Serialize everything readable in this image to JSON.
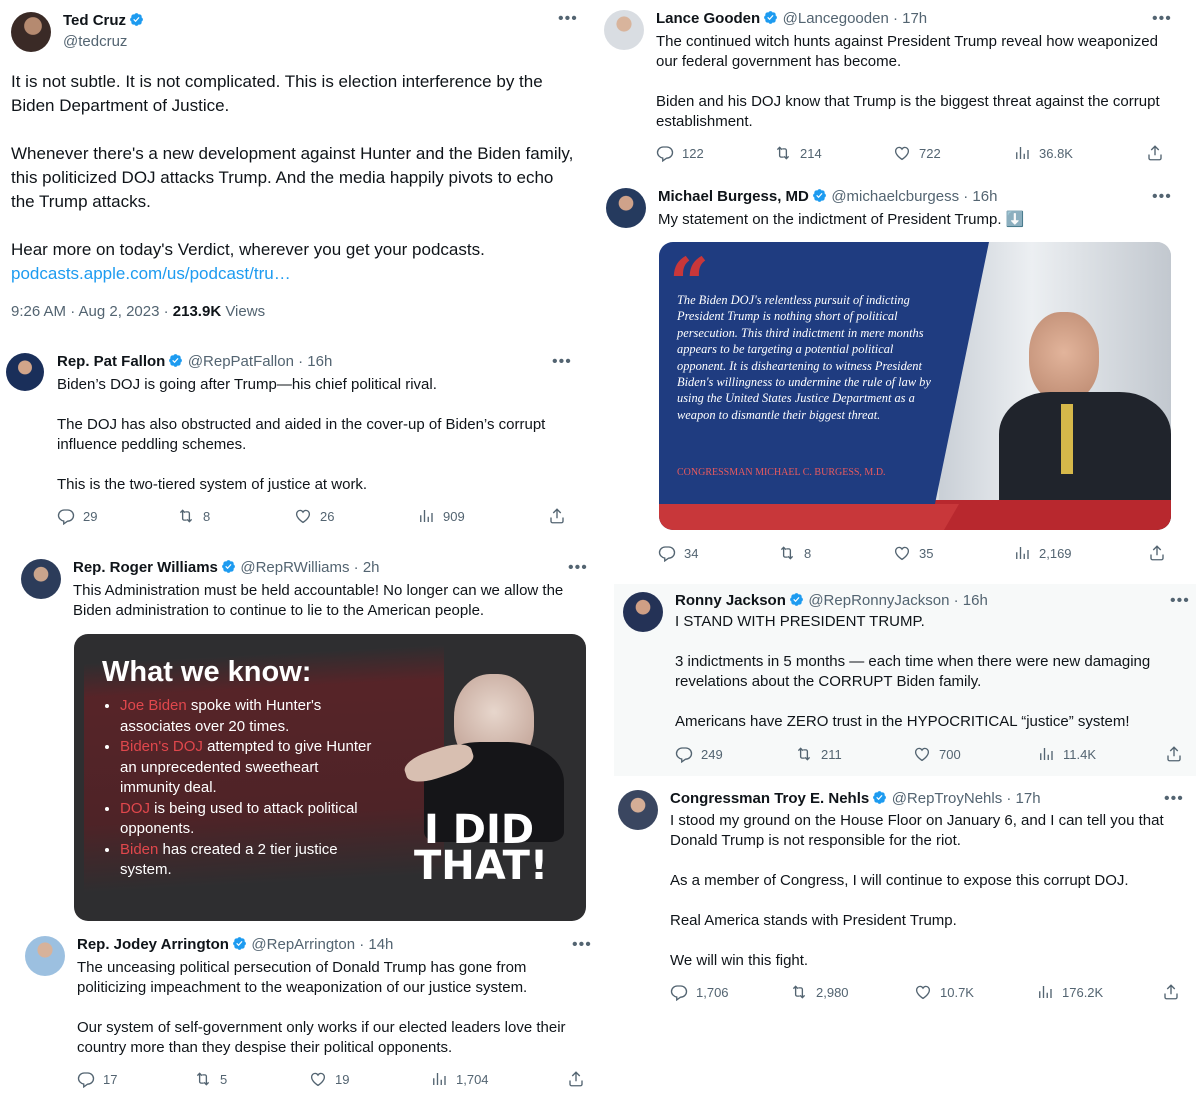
{
  "colors": {
    "accent": "#1d9bf0",
    "text": "#0f1419",
    "muted": "#536471",
    "verified": "#1d9bf0",
    "gray_bg": "#f7f9f9",
    "doj_blue": "#1e3a78",
    "doj_red": "#c8373a"
  },
  "icons": {
    "reply": "reply-icon",
    "repost": "repost-icon",
    "like": "like-icon",
    "views": "views-icon",
    "share": "share-icon",
    "verified": "verified-badge-icon",
    "more": "more-icon"
  },
  "cruz": {
    "name": "Ted Cruz",
    "handle": "@tedcruz",
    "p1": "It is not subtle. It is not complicated. This is election interference by the Biden Department of Justice.",
    "p2": "Whenever there's a new development against Hunter and the Biden family, this politicized DOJ attacks Trump. And the media happily pivots to echo the Trump attacks.",
    "p3": "Hear more on today's Verdict, wherever you get your podcasts.",
    "link": "podcasts.apple.com/us/podcast/tru…",
    "time": "9:26 AM · Aug 2, 2023 · ",
    "views_count": "213.9K",
    "views_label": " Views"
  },
  "fallon": {
    "name": "Rep. Pat Fallon",
    "meta": "@RepPatFallon · 16h",
    "p1": "Biden’s DOJ is going after Trump—his chief political rival.",
    "p2": "The DOJ has also obstructed and aided in the cover-up of Biden’s corrupt influence peddling schemes.",
    "p3": "This is the two-tiered system of justice at work.",
    "replies": "29",
    "reposts": "8",
    "likes": "26",
    "views": "909"
  },
  "williams": {
    "name": "Rep. Roger Williams",
    "meta": "@RepRWilliams · 2h",
    "p1": "This Administration must be held accountable!  No longer can we allow the Biden administration to continue to lie to the American people.",
    "graphic": {
      "title": "What we know:",
      "b1_hl": "Joe Biden",
      "b1_rest": " spoke with Hunter's associates over 20 times.",
      "b2_hl": "Biden's DOJ",
      "b2_rest": " attempted to give Hunter an unprecedented sweetheart immunity deal.",
      "b3_hl": "DOJ",
      "b3_rest": " is being used to attack political opponents.",
      "b4_hl": "Biden",
      "b4_rest": " has created a 2 tier justice system.",
      "caption1": "I DID",
      "caption2": "THAT!"
    }
  },
  "arrington": {
    "name": "Rep. Jodey Arrington",
    "meta": "@RepArrington · 14h",
    "p1": "The unceasing political persecution of Donald Trump has gone from politicizing impeachment to the weaponization of our justice system.",
    "p2": "Our system of self-government only works if our elected leaders love their country more than they despise their political opponents.",
    "replies": "17",
    "reposts": "5",
    "likes": "19",
    "views": "1,704"
  },
  "gooden": {
    "name": "Lance Gooden",
    "meta": "@Lancegooden · 17h",
    "p1": "The continued witch hunts against President Trump reveal how weaponized our federal government has become.",
    "p2": "Biden and his DOJ know that Trump is the biggest threat against the corrupt establishment.",
    "replies": "122",
    "reposts": "214",
    "likes": "722",
    "views": "36.8K"
  },
  "burgess": {
    "name": "Michael Burgess, MD",
    "meta": "@michaelcburgess · 16h",
    "p1": "My statement on the indictment of President Trump. ⬇️",
    "quote": "The Biden DOJ's relentless pursuit of indicting President Trump is nothing short of political persecution. This third indictment in mere months appears to be targeting a potential political opponent. It is disheartening to witness President Biden's willingness to undermine the rule of law by using the United States Justice Department as a weapon to dismantle their biggest threat.",
    "signature": "CONGRESSMAN MICHAEL C. BURGESS, M.D.",
    "replies": "34",
    "reposts": "8",
    "likes": "35",
    "views": "2,169"
  },
  "jackson": {
    "name": "Ronny Jackson",
    "meta": "@RepRonnyJackson · 16h",
    "p1": "I STAND WITH PRESIDENT TRUMP.",
    "p2": "3 indictments in 5 months — each time when there were new damaging revelations about the CORRUPT Biden family.",
    "p3": "Americans have ZERO trust in the HYPOCRITICAL “justice” system!",
    "replies": "249",
    "reposts": "211",
    "likes": "700",
    "views": "11.4K"
  },
  "nehls": {
    "name": "Congressman Troy E. Nehls",
    "meta": "@RepTroyNehls · 17h",
    "p1": "I stood my ground on the House Floor on January 6, and I can tell you that Donald Trump is not responsible for the riot.",
    "p2": "As a member of Congress, I will continue to expose this corrupt DOJ.",
    "p3": "Real America stands with President Trump.",
    "p4": "We will win this fight.",
    "replies": "1,706",
    "reposts": "2,980",
    "likes": "10.7K",
    "views": "176.2K"
  }
}
